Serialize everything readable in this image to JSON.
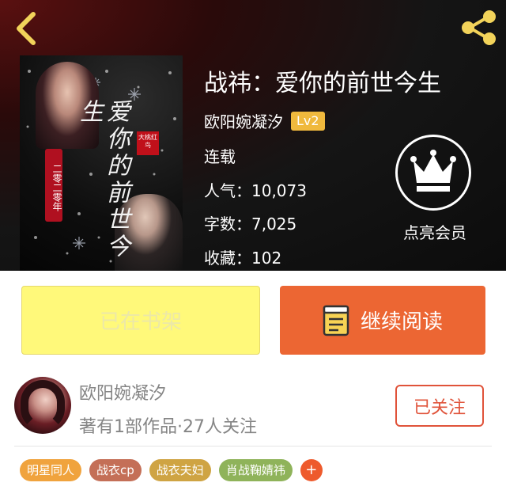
{
  "book": {
    "title": "战祎：爱你的前世今生",
    "author": "欧阳婉凝汐",
    "author_level": "Lv2",
    "status": "连载",
    "popularity": "人气：10,073",
    "word_count": "字数：7,025",
    "favorites": "收藏：102",
    "cover": {
      "vertical_title": "爱你的前世今生",
      "side_text": "二零二零年",
      "stamp_text": "大桃红鸟"
    }
  },
  "vip": {
    "label": "点亮会员"
  },
  "actions": {
    "shelf_label": "已在书架",
    "read_label": "继续阅读"
  },
  "author_card": {
    "name": "欧阳婉凝汐",
    "stats": "著有1部作品·27人关注",
    "follow_label": "已关注"
  },
  "tags": [
    {
      "label": "明星同人",
      "color": "#f0a33d"
    },
    {
      "label": "战衣cp",
      "color": "#c46f57"
    },
    {
      "label": "战衣夫妇",
      "color": "#cfa443"
    },
    {
      "label": "肖战鞠婧祎",
      "color": "#8fb35a"
    }
  ],
  "tag_add_label": "+",
  "colors": {
    "accent": "#ec6633",
    "shelf_button": "#fff97a",
    "level_badge": "#f0b93d",
    "icon_yellow": "#f2d35a"
  },
  "icons": {
    "back": "chevron-left-icon",
    "share": "share-icon",
    "vip": "crown-icon",
    "read": "book-icon"
  }
}
